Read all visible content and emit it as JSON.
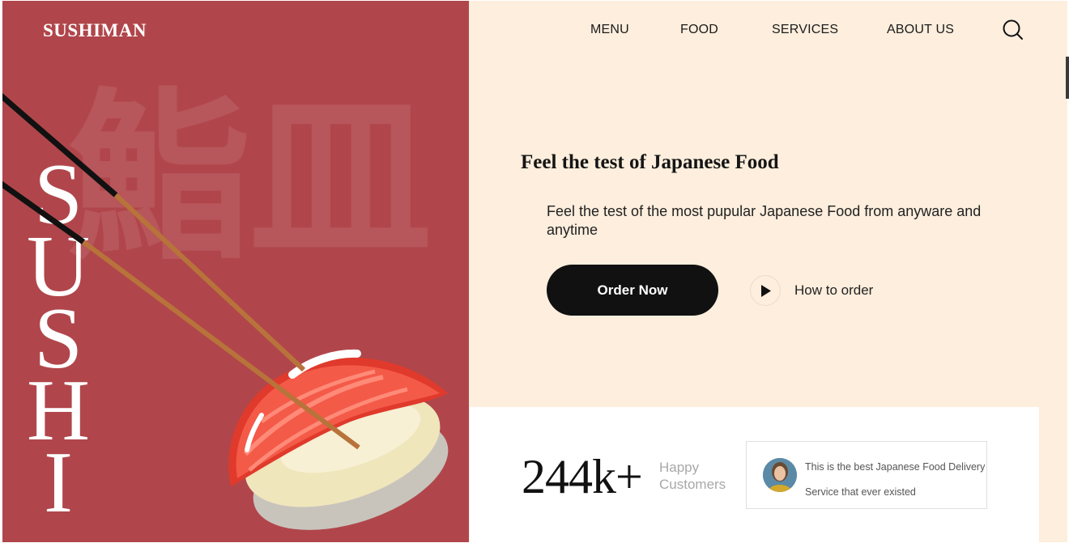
{
  "brand": {
    "logo": "SUSHIMAN",
    "vertical_text": [
      "S",
      "U",
      "S",
      "H",
      "I"
    ],
    "watermark": "鮨皿"
  },
  "nav": {
    "items": [
      "MENU",
      "FOOD",
      "SERVICES",
      "ABOUT US"
    ]
  },
  "hero": {
    "title": "Feel the test of Japanese Food",
    "description": "Feel the test of the most pupular Japanese Food from anyware and anytime",
    "order_button": "Order Now",
    "how_to_order": "How to order"
  },
  "stats": {
    "number": "244k+",
    "label_line1": "Happy",
    "label_line2": "Customers"
  },
  "review": {
    "line1": "This is the best Japanese Food Delivery",
    "line2": "Service that ever existed"
  },
  "colors": {
    "left_panel": "#b0464b",
    "right_panel": "#fdeedd",
    "button": "#111111"
  }
}
